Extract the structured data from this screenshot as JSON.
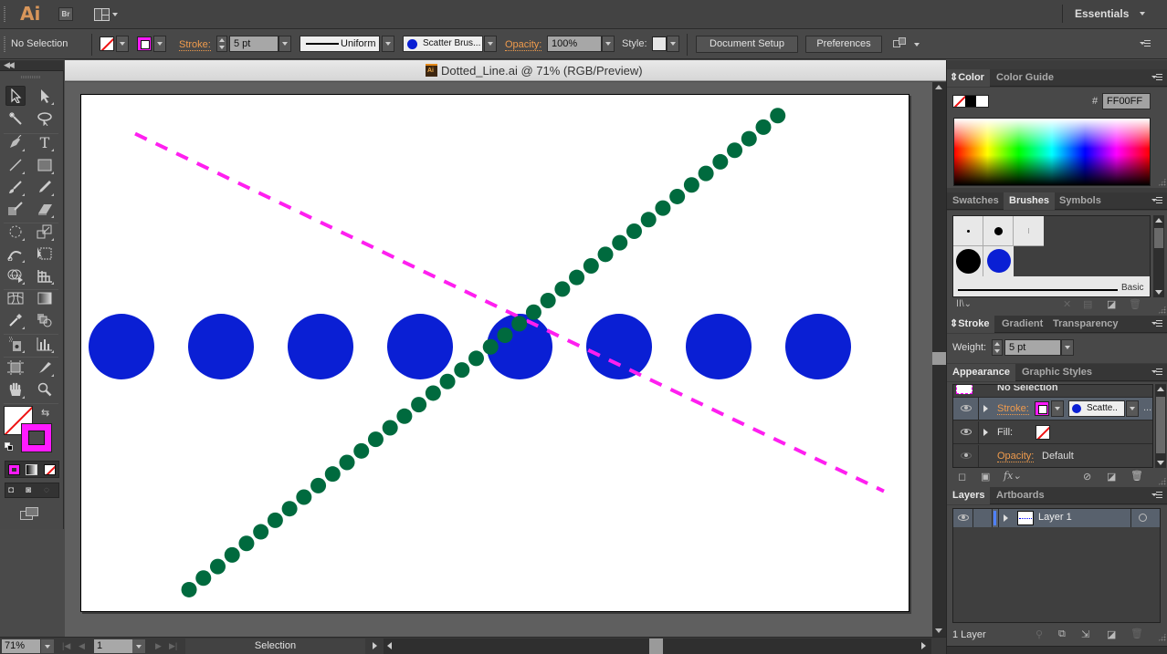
{
  "app": {
    "logo": "Ai",
    "bridge_label": "Br",
    "workspace": "Essentials"
  },
  "control_bar": {
    "selection_status": "No Selection",
    "stroke_label": "Stroke:",
    "stroke_weight": "5 pt",
    "profile_label": "Uniform",
    "brush_label": "Scatter Brus...",
    "opacity_label": "Opacity:",
    "opacity_value": "100%",
    "style_label": "Style:",
    "document_setup_label": "Document Setup",
    "preferences_label": "Preferences"
  },
  "colors": {
    "stroke": "#FF00FF",
    "brush_fill": "#0A1FD4",
    "dots": "#006A3E",
    "orange_label": "#EF9B4D"
  },
  "document": {
    "title": "Dotted_Line.ai @ 71% (RGB/Preview)",
    "icon_label": "Ai",
    "artwork": {
      "dashed_line": {
        "color": "#FF1FF0",
        "from": [
          0.065,
          0.075
        ],
        "to": [
          0.968,
          0.765
        ],
        "dash": "dashed"
      },
      "dotted_line": {
        "color": "#006A3E",
        "from": [
          0.13,
          0.955
        ],
        "to": [
          0.84,
          0.04
        ],
        "dot_count": 42
      },
      "circles": {
        "color": "#0A1FD4",
        "count": 8
      }
    }
  },
  "status_bar": {
    "zoom": "71%",
    "page": "1",
    "mode": "Selection"
  },
  "panels": {
    "color": {
      "tabs": [
        "Color",
        "Color Guide"
      ],
      "hex_label": "#",
      "hex_value": "FF00FF"
    },
    "brushes": {
      "tabs": [
        "Swatches",
        "Brushes",
        "Symbols"
      ],
      "basic_label": "Basic"
    },
    "stroke": {
      "tabs": [
        "Stroke",
        "Gradient",
        "Transparency"
      ],
      "weight_label": "Weight:",
      "weight_value": "5 pt"
    },
    "appearance": {
      "tabs": [
        "Appearance",
        "Graphic Styles"
      ],
      "header": "No Selection",
      "stroke_label": "Stroke:",
      "stroke_brush": "Scatte..",
      "more": "...",
      "fill_label": "Fill:",
      "opacity_label": "Opacity:",
      "opacity_value": "Default",
      "fx_label": "fx"
    },
    "layers": {
      "tabs": [
        "Layers",
        "Artboards"
      ],
      "items": [
        {
          "name": "Layer 1"
        }
      ],
      "count_label": "1 Layer"
    }
  }
}
